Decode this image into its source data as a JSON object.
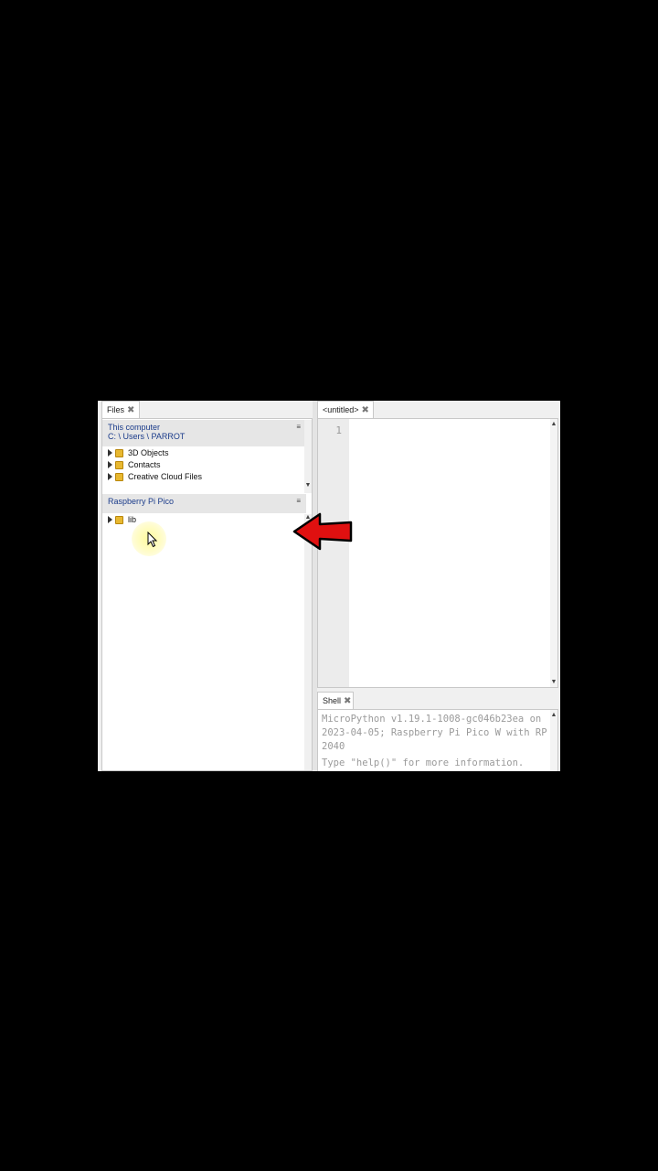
{
  "files_panel": {
    "tab_label": "Files",
    "this_computer": {
      "title": "This computer",
      "path": "C: \\ Users \\ PARROT",
      "items": [
        "3D Objects",
        "Contacts",
        "Creative Cloud Files"
      ]
    },
    "device": {
      "title": "Raspberry Pi Pico",
      "items": [
        "lib"
      ]
    }
  },
  "editor": {
    "tab_label": "<untitled>",
    "line_numbers": [
      "1"
    ]
  },
  "shell": {
    "tab_label": "Shell",
    "banner": "MicroPython v1.19.1-1008-gc046b23ea on 2023-04-05; Raspberry Pi Pico W with RP2040",
    "help_line": "Type \"help()\" for more information."
  },
  "icons": {
    "close": "close-icon",
    "menu": "menu-icon",
    "expand": "expand-triangle-icon",
    "folder": "folder-icon",
    "annotation": "red-arrow-icon",
    "pointer": "mouse-cursor-icon"
  },
  "colors": {
    "folder": "#e8b830",
    "arrow": "#e01010",
    "section_title": "#1a3b8a"
  }
}
